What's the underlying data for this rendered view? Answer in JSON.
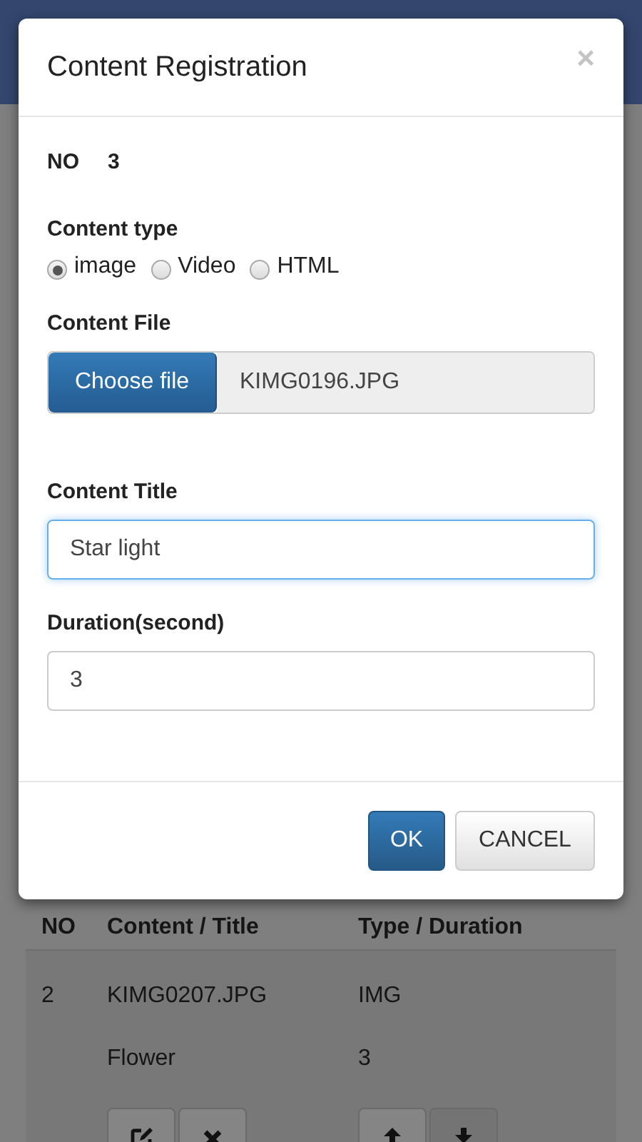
{
  "background": {
    "table": {
      "columns": [
        "NO",
        "Content / Title",
        "Type / Duration"
      ],
      "rows": [
        {
          "no": "2",
          "content": "KIMG0207.JPG",
          "type": "IMG",
          "title": "Flower",
          "duration": "3"
        }
      ]
    }
  },
  "dialog": {
    "title": "Content Registration",
    "close": "×",
    "no": {
      "label": "NO",
      "value": "3"
    },
    "content_type": {
      "label": "Content type",
      "options": [
        {
          "label": "image",
          "selected": true
        },
        {
          "label": "Video",
          "selected": false
        },
        {
          "label": "HTML",
          "selected": false
        }
      ]
    },
    "content_file": {
      "label": "Content File",
      "button": "Choose file",
      "file_name": "KIMG0196.JPG"
    },
    "content_title": {
      "label": "Content Title",
      "value": "Star light",
      "focused": true
    },
    "duration": {
      "label": "Duration(second)",
      "value": "3",
      "focused": false
    },
    "buttons": [
      {
        "label": "OK",
        "kind": "primary"
      },
      {
        "label": "CANCEL",
        "kind": "default"
      }
    ]
  }
}
